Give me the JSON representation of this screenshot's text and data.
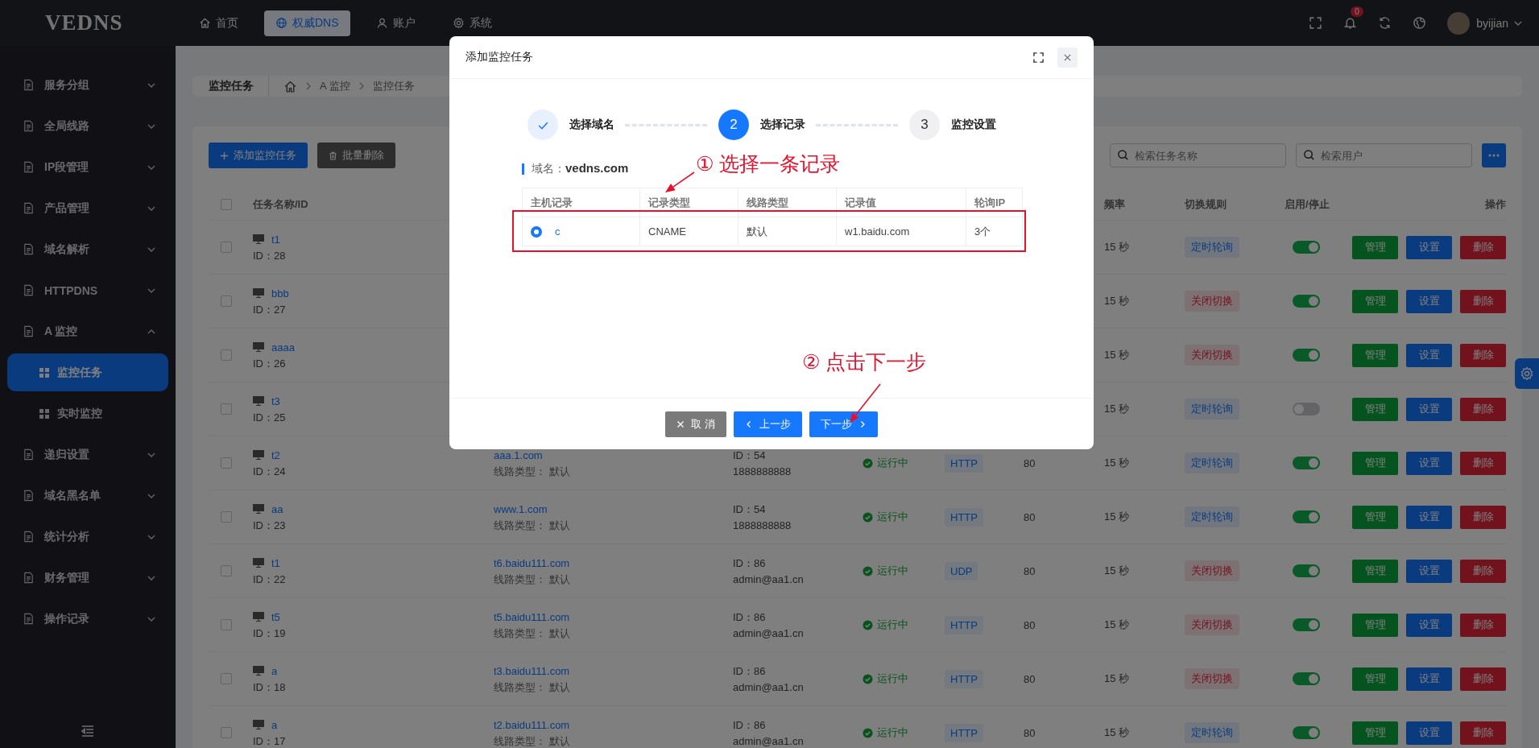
{
  "topbar": {
    "logo": "VEDNS",
    "nav": [
      {
        "label": "首页",
        "selected": false
      },
      {
        "label": "权威DNS",
        "selected": true
      },
      {
        "label": "账户",
        "selected": false
      },
      {
        "label": "系统",
        "selected": false
      }
    ],
    "notifications": "0",
    "user": "byijian"
  },
  "sidebar": {
    "items": [
      {
        "label": "服务分组",
        "expanded": false
      },
      {
        "label": "全局线路",
        "expanded": false
      },
      {
        "label": "IP段管理",
        "expanded": false
      },
      {
        "label": "产品管理",
        "expanded": false
      },
      {
        "label": "域名解析",
        "expanded": false
      },
      {
        "label": "HTTPDNS",
        "expanded": false
      },
      {
        "label": "A 监控",
        "expanded": true,
        "children": [
          {
            "label": "监控任务",
            "selected": true
          },
          {
            "label": "实时监控",
            "selected": false
          }
        ]
      },
      {
        "label": "递归设置",
        "expanded": false
      },
      {
        "label": "域名黑名单",
        "expanded": false
      },
      {
        "label": "统计分析",
        "expanded": false
      },
      {
        "label": "财务管理",
        "expanded": false
      },
      {
        "label": "操作记录",
        "expanded": false
      }
    ]
  },
  "breadcrumb": {
    "title": "监控任务",
    "path": [
      "A 监控",
      "监控任务"
    ]
  },
  "toolbar": {
    "buttons": [
      {
        "label": "添加监控任务",
        "kind": "add"
      },
      {
        "label": "批量删除",
        "kind": "delete"
      }
    ],
    "searches": [
      {
        "placeholder": "检索任务名称"
      },
      {
        "placeholder": "检索用户"
      }
    ]
  },
  "table": {
    "all_checked": false,
    "columns": [
      "任务名称/ID",
      "频率",
      "切换规则",
      "启用/停止",
      "操作"
    ],
    "rows": [
      {
        "checked": false,
        "name": "t1",
        "id": "ID：28",
        "frequency": "15 秒",
        "rule": {
          "label": "定时轮询",
          "kind": "timed"
        },
        "enabled": true,
        "actions": [
          "管理",
          "设置",
          "删除"
        ]
      },
      {
        "checked": false,
        "name": "bbb",
        "id": "ID：27",
        "frequency": "15 秒",
        "rule": {
          "label": "关闭切换",
          "kind": "off"
        },
        "enabled": true,
        "actions": [
          "管理",
          "设置",
          "删除"
        ]
      },
      {
        "checked": false,
        "name": "aaaa",
        "id": "ID：26",
        "frequency": "15 秒",
        "rule": {
          "label": "关闭切换",
          "kind": "off"
        },
        "enabled": true,
        "actions": [
          "管理",
          "设置",
          "删除"
        ]
      },
      {
        "checked": false,
        "name": "t3",
        "id": "ID：25",
        "frequency": "15 秒",
        "rule": {
          "label": "定时轮询",
          "kind": "timed"
        },
        "enabled": false,
        "actions": [
          "管理",
          "设置",
          "删除"
        ]
      },
      {
        "checked": false,
        "name": "t2",
        "id": "ID：24",
        "domain": "aaa.1.com",
        "line_type": "线路类型： 默认",
        "user_id": "ID：54",
        "user": "1888888888",
        "status": "运行中",
        "protocol": "HTTP",
        "port": "80",
        "frequency": "15 秒",
        "rule": {
          "label": "定时轮询",
          "kind": "timed"
        },
        "enabled": true,
        "actions": [
          "管理",
          "设置",
          "删除"
        ]
      },
      {
        "checked": false,
        "name": "aa",
        "id": "ID：23",
        "domain": "www.1.com",
        "line_type": "线路类型： 默认",
        "user_id": "ID：54",
        "user": "1888888888",
        "status": "运行中",
        "protocol": "HTTP",
        "port": "80",
        "frequency": "15 秒",
        "rule": {
          "label": "定时轮询",
          "kind": "timed"
        },
        "enabled": true,
        "actions": [
          "管理",
          "设置",
          "删除"
        ]
      },
      {
        "checked": false,
        "name": "t1",
        "id": "ID：22",
        "domain": "t6.baidu111.com",
        "line_type": "线路类型： 默认",
        "user_id": "ID：86",
        "user": "admin@aa1.cn",
        "status": "运行中",
        "protocol": "UDP",
        "port": "80",
        "frequency": "15 秒",
        "rule": {
          "label": "关闭切换",
          "kind": "off"
        },
        "enabled": true,
        "actions": [
          "管理",
          "设置",
          "删除"
        ]
      },
      {
        "checked": false,
        "name": "t5",
        "id": "ID：19",
        "domain": "t5.baidu111.com",
        "line_type": "线路类型： 默认",
        "user_id": "ID：86",
        "user": "admin@aa1.cn",
        "status": "运行中",
        "protocol": "HTTP",
        "port": "80",
        "frequency": "15 秒",
        "rule": {
          "label": "关闭切换",
          "kind": "off"
        },
        "enabled": true,
        "actions": [
          "管理",
          "设置",
          "删除"
        ]
      },
      {
        "checked": false,
        "name": "a",
        "id": "ID：18",
        "domain": "t3.baidu111.com",
        "line_type": "线路类型： 默认",
        "user_id": "ID：86",
        "user": "admin@aa1.cn",
        "status": "运行中",
        "protocol": "HTTP",
        "port": "80",
        "frequency": "15 秒",
        "rule": {
          "label": "关闭切换",
          "kind": "off"
        },
        "enabled": true,
        "actions": [
          "管理",
          "设置",
          "删除"
        ]
      },
      {
        "checked": false,
        "name": "a",
        "id": "ID：17",
        "domain": "t2.baidu111.com",
        "line_type": "线路类型： 默认",
        "user_id": "ID：86",
        "user": "admin@aa1.cn",
        "status": "运行中",
        "protocol": "HTTP",
        "port": "80",
        "frequency": "15 秒",
        "rule": {
          "label": "定时轮询",
          "kind": "timed"
        },
        "enabled": true,
        "actions": [
          "管理",
          "设置",
          "删除"
        ]
      }
    ]
  },
  "dialog": {
    "title": "添加监控任务",
    "steps": [
      {
        "label": "选择域名",
        "done": true,
        "current": false
      },
      {
        "number": "2",
        "label": "选择记录",
        "done": false,
        "current": true
      },
      {
        "number": "3",
        "label": "监控设置",
        "done": false,
        "current": false
      }
    ],
    "domain": "域名：**vedns.com**",
    "records": {
      "columns": [
        "主机记录",
        "记录类型",
        "线路类型",
        "记录值",
        "轮询IP"
      ],
      "rows": [
        {
          "selected": true,
          "cells": [
            "c",
            "CNAME",
            "默认",
            "w1.baidu.com",
            "3个"
          ]
        }
      ]
    },
    "annotations": [
      "① 选择一条记录",
      "② 点击下一步"
    ],
    "buttons": [
      {
        "label": "取 消",
        "kind": "cancel"
      },
      {
        "label": "上一步",
        "kind": "prev"
      },
      {
        "label": "下一步",
        "kind": "next"
      }
    ]
  }
}
